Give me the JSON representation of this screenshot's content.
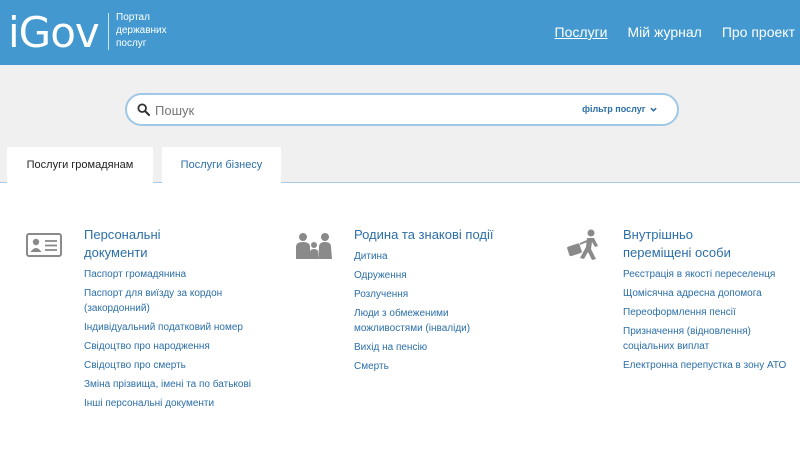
{
  "header": {
    "logo": "iGov",
    "subtitle": [
      "Портал",
      "державних",
      "послуг"
    ],
    "nav": [
      {
        "label": "Послуги",
        "active": true
      },
      {
        "label": "Мій журнал",
        "active": false
      },
      {
        "label": "Про проект",
        "active": false
      }
    ]
  },
  "search": {
    "placeholder": "Пошук",
    "filter_label": "фільтр послуг"
  },
  "tabs": [
    {
      "label": "Послуги громадянам",
      "active": true
    },
    {
      "label": "Послуги бізнесу",
      "active": false
    }
  ],
  "categories": [
    {
      "icon": "id-card-icon",
      "title": "Персональні документи",
      "links": [
        "Паспорт громадянина",
        "Паспорт для виїзду за кордон (закордонний)",
        "Індивідуальний податковий номер",
        "Свідоцтво про народження",
        "Свідоцтво про смерть",
        "Зміна прізвища, імені та по батькові",
        "Інші персональні документи"
      ]
    },
    {
      "icon": "family-icon",
      "title": "Родина та знакові події",
      "links": [
        "Дитина",
        "Одруження",
        "Розлучення",
        "Люди з обмеженими можливостями (інваліди)",
        "Вихід на пенсію",
        "Смерть"
      ]
    },
    {
      "icon": "displaced-person-icon",
      "title": "Внутрішньо переміщені особи",
      "links": [
        "Реєстрація в якості переселенця",
        "Щомісячна адресна допомога",
        "Переоформлення пенсії",
        "Призначення (відновлення) соціальних виплат",
        "Електронна перепустка в зону АТО"
      ]
    }
  ],
  "colors": {
    "header_bg": "#4399cf",
    "link": "#2c6fa8",
    "search_band_bg": "#f0f0f0"
  }
}
